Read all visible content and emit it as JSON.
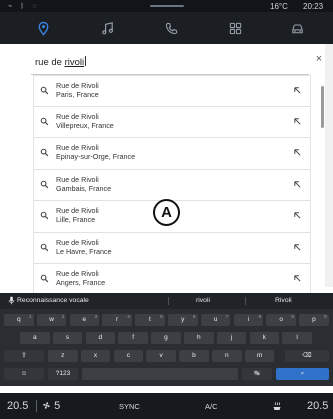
{
  "status": {
    "temperature": "16°C",
    "time": "20:23"
  },
  "tabs": [
    {
      "icon": "map-pin-icon",
      "active": true
    },
    {
      "icon": "music-note-icon",
      "active": false
    },
    {
      "icon": "phone-icon",
      "active": false
    },
    {
      "icon": "apps-grid-icon",
      "active": false
    },
    {
      "icon": "car-icon",
      "active": false
    }
  ],
  "search": {
    "query_prefix": "rue de ",
    "query_word": "rivoli",
    "clear_label": "×"
  },
  "results": [
    {
      "title": "Rue de Rivoli",
      "subtitle": "Paris, France"
    },
    {
      "title": "Rue de Rivoli",
      "subtitle": "Villepreux, France"
    },
    {
      "title": "Rue de Rivoli",
      "subtitle": "Epinay-sur-Orge, France"
    },
    {
      "title": "Rue de Rivoli",
      "subtitle": "Gambais, France"
    },
    {
      "title": "Rue de Rivoli",
      "subtitle": "Lille, France"
    },
    {
      "title": "Rue de Rivoli",
      "subtitle": "Le Havre, France"
    },
    {
      "title": "Rue de Rivoli",
      "subtitle": "Angers, France"
    }
  ],
  "callout": "A",
  "keyboard": {
    "voice_label": "Reconnaissance vocale",
    "suggestions": [
      "rivoli",
      "Rivoli"
    ],
    "row1": [
      "q",
      "w",
      "e",
      "r",
      "t",
      "y",
      "u",
      "i",
      "o",
      "p"
    ],
    "row1_hints": [
      "1",
      "2",
      "3",
      "4",
      "5",
      "6",
      "7",
      "8",
      "9",
      "0"
    ],
    "row2": [
      "a",
      "s",
      "d",
      "f",
      "g",
      "h",
      "j",
      "k",
      "l"
    ],
    "row3": [
      "z",
      "x",
      "c",
      "v",
      "b",
      "n",
      "m"
    ],
    "shift_label": "⇧",
    "backspace_label": "⌫",
    "numbers_label": "?123",
    "emoji_label": "☺",
    "search_label": "⌕",
    "cursor_label": "↹"
  },
  "climate": {
    "left_temp": "20.5",
    "fan_level": "5",
    "sync_label": "SYNC",
    "ac_label": "A/C",
    "right_temp": "20.5"
  },
  "colors": {
    "accent": "#2f72c9",
    "panel_bg": "#ffffff",
    "dark_bar": "#1b1f24",
    "keyboard_bg": "#2a2d31"
  }
}
